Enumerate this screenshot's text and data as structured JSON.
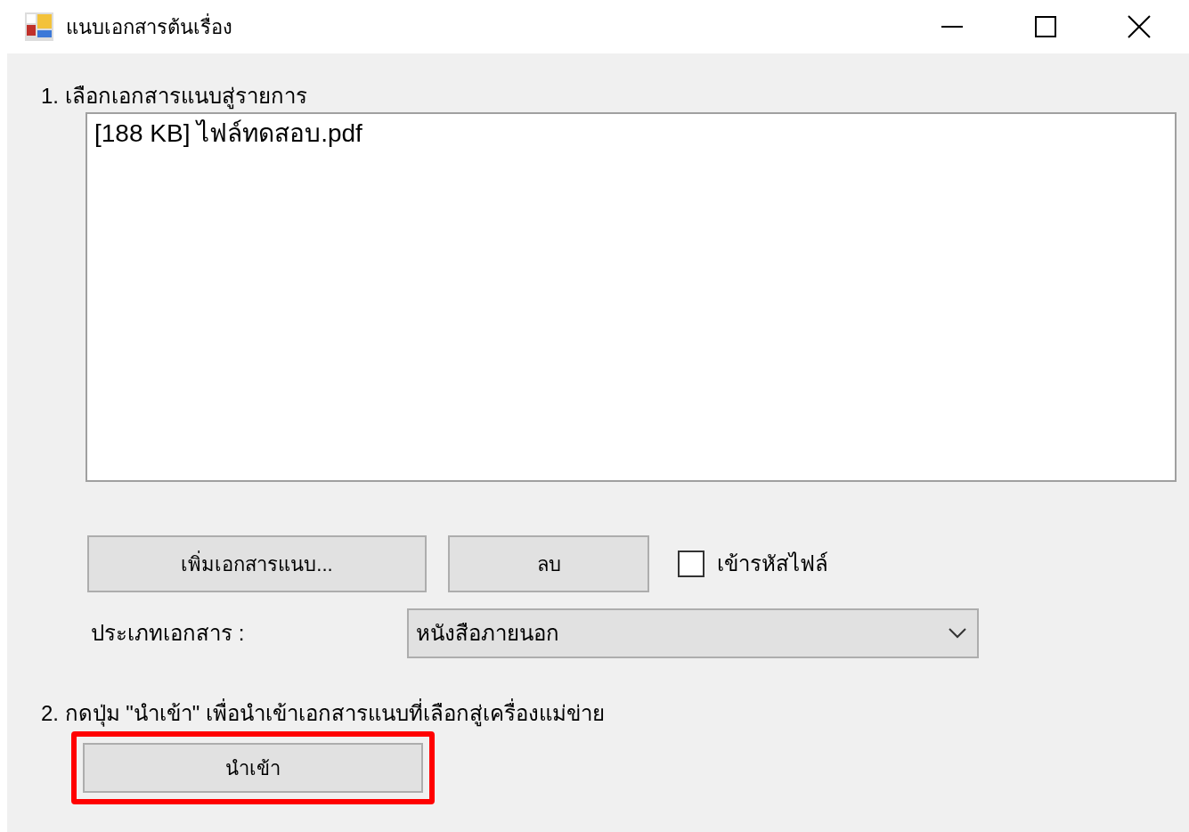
{
  "window": {
    "title": "แนบเอกสารต้นเรื่อง"
  },
  "step1": {
    "label": "1. เลือกเอกสารแนบสู่รายการ"
  },
  "file_list": {
    "items": [
      {
        "text": "[188 KB] ไฟล์ทดสอบ.pdf",
        "selected": false
      }
    ]
  },
  "buttons": [
    {
      "label": "เพิ่มเอกสารแนบ..."
    },
    {
      "label": "ลบ"
    }
  ],
  "encrypt": {
    "label": "เข้ารหัสไฟล์",
    "checked": false
  },
  "document_type": {
    "label": "ประเภทเอกสาร :",
    "value": "หนังสือภายนอก"
  },
  "step2": {
    "label": "2. กดปุ่ม \"นำเข้า\" เพื่อนำเข้าเอกสารแนบที่เลือกสู่เครื่องแม่ข่าย"
  },
  "import_button": {
    "label": "นำเข้า",
    "highlighted": true
  }
}
